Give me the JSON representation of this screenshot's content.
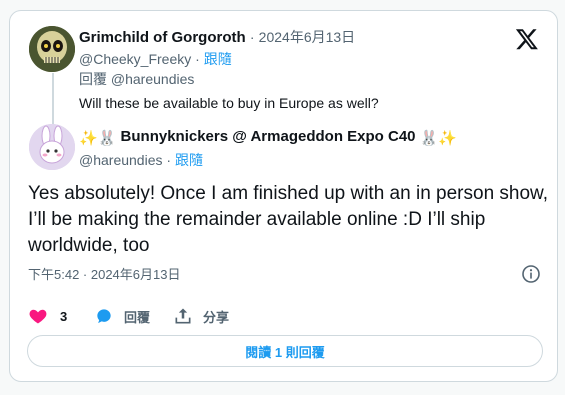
{
  "parent": {
    "display_name": "Grimchild of Gorgoroth",
    "separator": "·",
    "date": "2024年6月13日",
    "handle": "@Cheeky_Freeky",
    "follow_label": "跟隨",
    "reply_to_label": "回覆",
    "reply_to_handle": "@hareundies",
    "text": "Will these be available to buy in Europe as well?"
  },
  "reply": {
    "display_name_pre_emoji": "✨🐰",
    "display_name": "Bunnyknickers @ Armageddon Expo C40",
    "display_name_post_emoji": "🐰✨",
    "handle": "@hareundies",
    "follow_label": "跟隨",
    "text": "Yes absolutely! Once I am finished up with an in person show, I’ll be making the remainder available online :D I’ll ship worldwide, too",
    "timestamp": "下午5:42 · 2024年6月13日"
  },
  "actions": {
    "like_count": "3",
    "reply_label": "回覆",
    "share_label": "分享"
  },
  "read_replies_label": "閱讀 1 則回覆",
  "colors": {
    "accent": "#1d9bf0",
    "like": "#f91880",
    "muted": "#536471",
    "border": "#cfd9de"
  },
  "icons": {
    "brand": "x-logo-icon",
    "info": "info-icon",
    "like": "heart-icon",
    "reply": "reply-bubble-icon",
    "share": "share-icon"
  }
}
